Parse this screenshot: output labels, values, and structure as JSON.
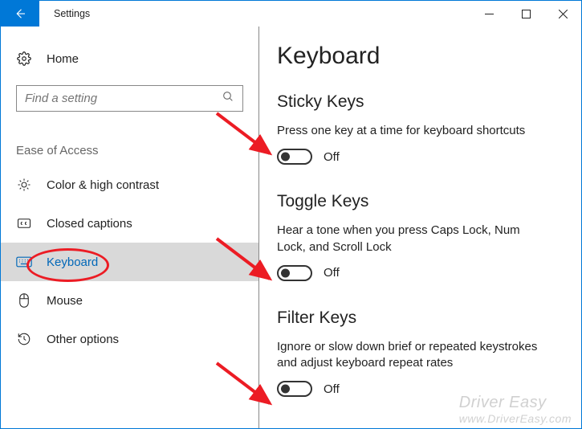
{
  "window": {
    "title": "Settings"
  },
  "sidebar": {
    "home": "Home",
    "search_placeholder": "Find a setting",
    "category": "Ease of Access",
    "items": [
      {
        "label": "Color & high contrast"
      },
      {
        "label": "Closed captions"
      },
      {
        "label": "Keyboard"
      },
      {
        "label": "Mouse"
      },
      {
        "label": "Other options"
      }
    ]
  },
  "content": {
    "page_title": "Keyboard",
    "sections": [
      {
        "title": "Sticky Keys",
        "desc": "Press one key at a time for keyboard shortcuts",
        "state": "Off"
      },
      {
        "title": "Toggle Keys",
        "desc": "Hear a tone when you press Caps Lock, Num Lock, and Scroll Lock",
        "state": "Off"
      },
      {
        "title": "Filter Keys",
        "desc": "Ignore or slow down brief or repeated keystrokes and adjust keyboard repeat rates",
        "state": "Off"
      }
    ]
  },
  "watermark": {
    "line1": "Driver Easy",
    "line2": "www.DriverEasy.com"
  }
}
